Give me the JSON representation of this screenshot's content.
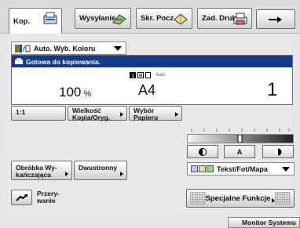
{
  "tabs": [
    {
      "label": "Kop.",
      "icon": "copy-icon"
    },
    {
      "label": "Wysyłanie",
      "icon": "send-icon"
    },
    {
      "label": "Skr. Pocz.",
      "icon": "mailbox-icon"
    },
    {
      "label": "Zad. Druku",
      "icon": "print-icon"
    }
  ],
  "arrow_label": "→",
  "color_mode": {
    "label": "Auto. Wyb. Koloru"
  },
  "status": {
    "message": "Gotowa do kopiowania.",
    "zoom_value": "100",
    "zoom_unit": "%",
    "paper_auto": "Auto",
    "paper_size": "A4",
    "copies": "1"
  },
  "buttons": {
    "ratio_1_1": "1:1",
    "size_ratio_line1": "Wielkość",
    "size_ratio_line2": "Kopia/Oryg.",
    "paper_select_line1": "Wybór",
    "paper_select_line2": "Papieru",
    "finishing_line1": "Obróbka Wy-",
    "finishing_line2": "kańczająca",
    "duplex": "Dwustronny",
    "interrupt_line1": "Przery-",
    "interrupt_line2": "wanie",
    "special_functions": "Specjalne Funkcje"
  },
  "density": {
    "auto_label": "A",
    "level": 0.5
  },
  "original_type": {
    "label": "Tekst/Fot/Mapa"
  },
  "system_monitor": "Monitor Systemu",
  "colors": {
    "status_bar": "#153a84",
    "accent": "#2a5bc6"
  }
}
